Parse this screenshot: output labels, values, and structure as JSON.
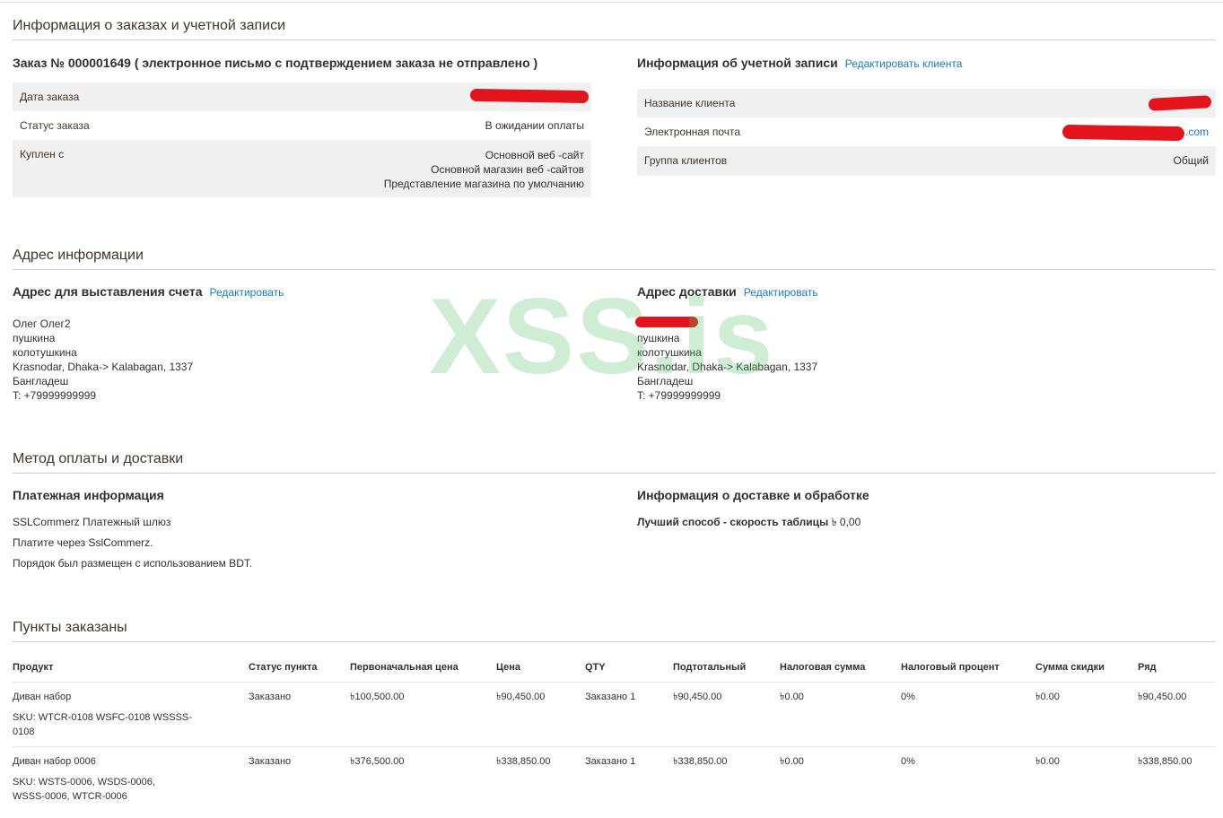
{
  "order_account": {
    "section_title": "Информация о заказах и учетной записи",
    "order_title": "Заказ № 000001649 ( электронное письмо с подтверждением заказа не отправлено )",
    "rows": [
      {
        "label": "Дата заказа",
        "value": ""
      },
      {
        "label": "Статус заказа",
        "value": "В ожидании оплаты"
      },
      {
        "label": "Куплен с",
        "value_lines": [
          "Основной веб -сайт",
          "Основной магазин веб -сайтов",
          "Представление магазина по умолчанию"
        ]
      }
    ],
    "account_title": "Информация об учетной записи",
    "account_edit": "Редактировать клиента",
    "account_rows": [
      {
        "label": "Название клиента",
        "value": ""
      },
      {
        "label": "Электронная почта",
        "value": ".com"
      },
      {
        "label": "Группа клиентов",
        "value": "Общий"
      }
    ]
  },
  "address": {
    "section_title": "Адрес информации",
    "billing_title": "Адрес для выставления счета",
    "billing_edit": "Редактировать",
    "billing_lines": [
      "Олег Олег2",
      "пушкина",
      "колотушкина",
      "Krasnodar, Dhaka-> Kalabagan, 1337",
      "Бангладеш",
      "T: +79999999999"
    ],
    "shipping_title": "Адрес доставки",
    "shipping_edit": "Редактировать",
    "shipping_lines": [
      "",
      "пушкина",
      "колотушкина",
      "Krasnodar, Dhaka-> Kalabagan, 1337",
      "Бангладеш",
      "T: +79999999999"
    ]
  },
  "payment_shipping": {
    "section_title": "Метод оплаты и доставки",
    "payment_title": "Платежная информация",
    "payment_lines": [
      "SSLCommerz Платежный шлюз",
      "Платите через SslCommerz.",
      "Порядок был размещен с использованием BDT."
    ],
    "shipping_title": "Информация о доставке и обработке",
    "shipping_method": "Лучший способ - скорость таблицы",
    "shipping_price": "৳ 0,00"
  },
  "items": {
    "section_title": "Пункты заказаны",
    "columns": [
      "Продукт",
      "Статус пункта",
      "Первоначальная цена",
      "Цена",
      "QTY",
      "Подтотальный",
      "Налоговая сумма",
      "Налоговый процент",
      "Сумма скидки",
      "Ряд"
    ],
    "rows": [
      {
        "product": "Диван набор",
        "sku": "SKU: WTCR-0108 WSFC-0108 WSSSS-0108",
        "status": "Заказано",
        "original_price": "৳100,500.00",
        "price": "৳90,450.00",
        "qty": "Заказано 1",
        "subtotal": "৳90,450.00",
        "tax_amount": "৳0.00",
        "tax_percent": "0%",
        "discount": "৳0.00",
        "row_total": "৳90,450.00"
      },
      {
        "product": "Диван набор 0006",
        "sku": "SKU: WSTS-0006, WSDS-0006, WSSS-0006, WTCR-0006",
        "status": "Заказано",
        "original_price": "৳376,500.00",
        "price": "৳338,850.00",
        "qty": "Заказано 1",
        "subtotal": "৳338,850.00",
        "tax_amount": "৳0.00",
        "tax_percent": "0%",
        "discount": "৳0.00",
        "row_total": "৳338,850.00"
      }
    ]
  },
  "watermark": "XSS.is",
  "colors": {
    "link": "#1979c3",
    "redaction": "#e3141b",
    "watermark": "#50be64",
    "row_shade": "#f0f0f0"
  }
}
